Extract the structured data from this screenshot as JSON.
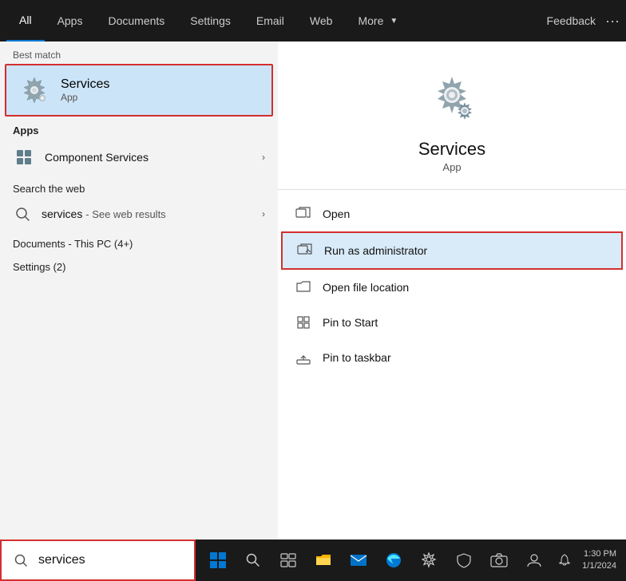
{
  "nav": {
    "tabs": [
      {
        "label": "All",
        "active": true
      },
      {
        "label": "Apps"
      },
      {
        "label": "Documents"
      },
      {
        "label": "Settings"
      },
      {
        "label": "Email"
      },
      {
        "label": "Web"
      },
      {
        "label": "More",
        "has_arrow": true
      }
    ],
    "feedback": "Feedback",
    "dots": "···"
  },
  "left_panel": {
    "best_match_label": "Best match",
    "best_match": {
      "name": "Services",
      "sub": "App"
    },
    "apps_label": "Apps",
    "apps": [
      {
        "name": "Component Services"
      }
    ],
    "search_web_label": "Search the web",
    "search_web_item": {
      "query": "services",
      "see_more": "- See web results"
    },
    "documents_label": "Documents - This PC (4+)",
    "settings_label": "Settings (2)"
  },
  "right_panel": {
    "app_name": "Services",
    "app_sub": "App",
    "actions": [
      {
        "label": "Open",
        "highlighted": false
      },
      {
        "label": "Run as administrator",
        "highlighted": true
      },
      {
        "label": "Open file location",
        "highlighted": false
      },
      {
        "label": "Pin to Start",
        "highlighted": false
      },
      {
        "label": "Pin to taskbar",
        "highlighted": false
      }
    ]
  },
  "taskbar": {
    "search_value": "services",
    "icons": [
      "⊞",
      "🔍",
      "📁",
      "✉",
      "🌐",
      "⚙",
      "🛡",
      "📷",
      "👤"
    ],
    "time": "1:30 PM\n1/1/2024"
  }
}
